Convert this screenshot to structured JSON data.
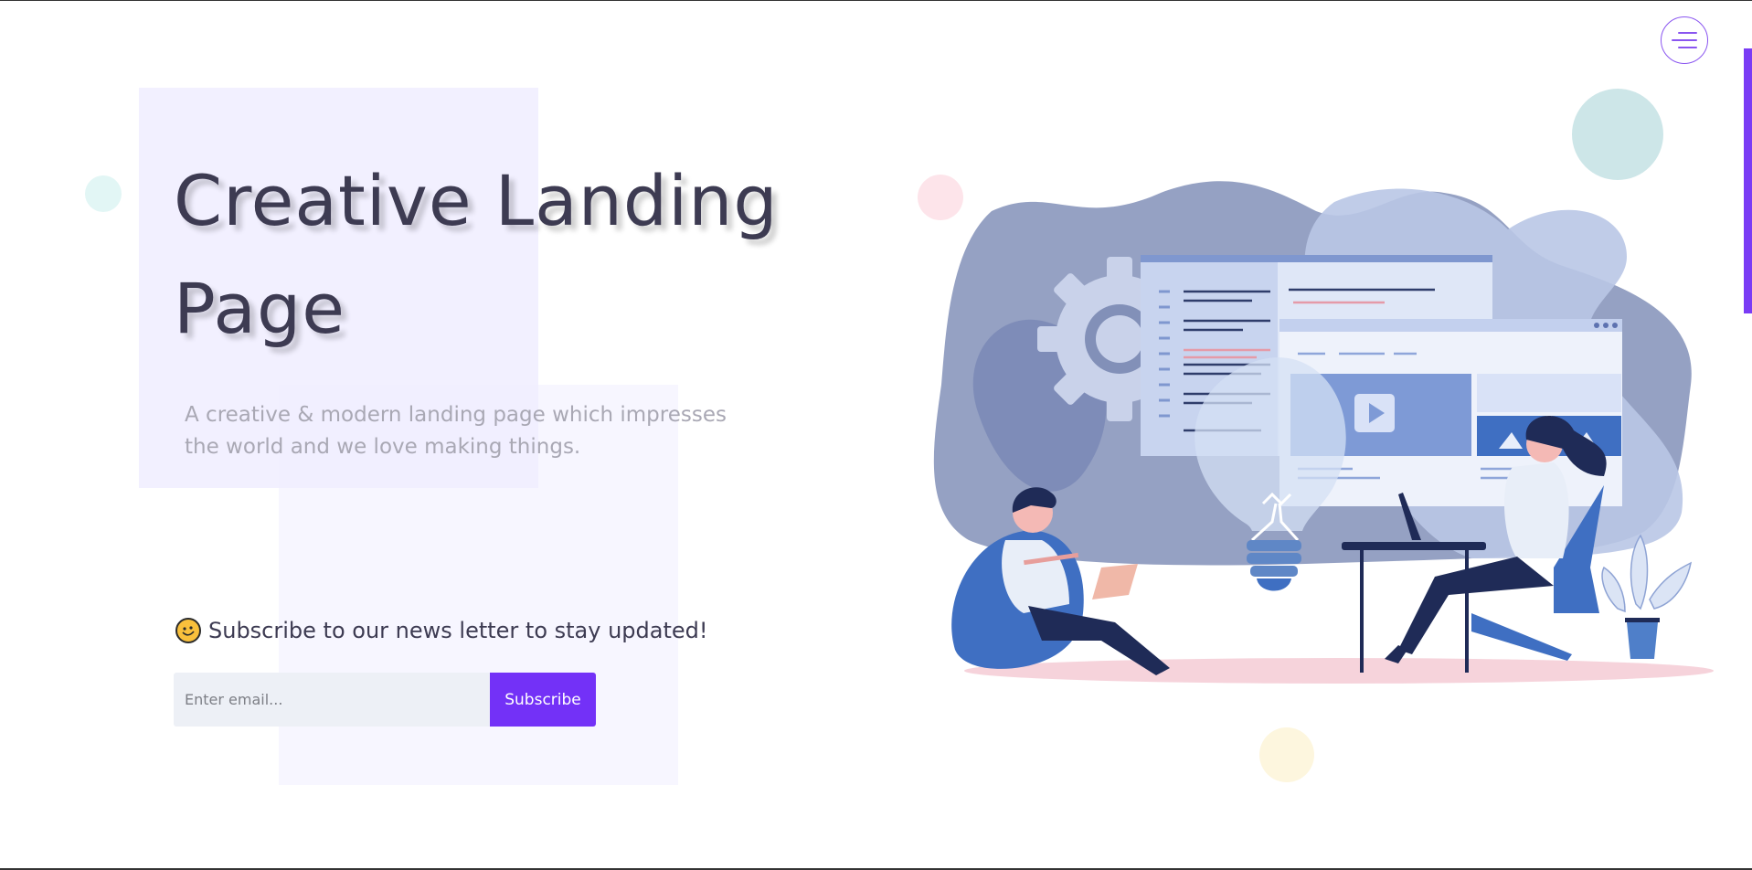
{
  "hero": {
    "title": "Creative Landing Page",
    "subtitle": "A creative & modern landing page which impresses the world and we love making things."
  },
  "newsletter": {
    "heading": "Subscribe to our news letter to stay updated!",
    "emoji_icon": "smiling-face-emoji",
    "email_placeholder": "Enter email...",
    "button_label": "Subscribe"
  },
  "nav": {
    "menu_icon": "hamburger-menu-icon"
  },
  "colors": {
    "accent": "#7331f7",
    "title": "#3d3b52",
    "subtitle": "#a9a8b4",
    "input_bg": "#edf0f6",
    "square_bg": "#f0edff"
  }
}
